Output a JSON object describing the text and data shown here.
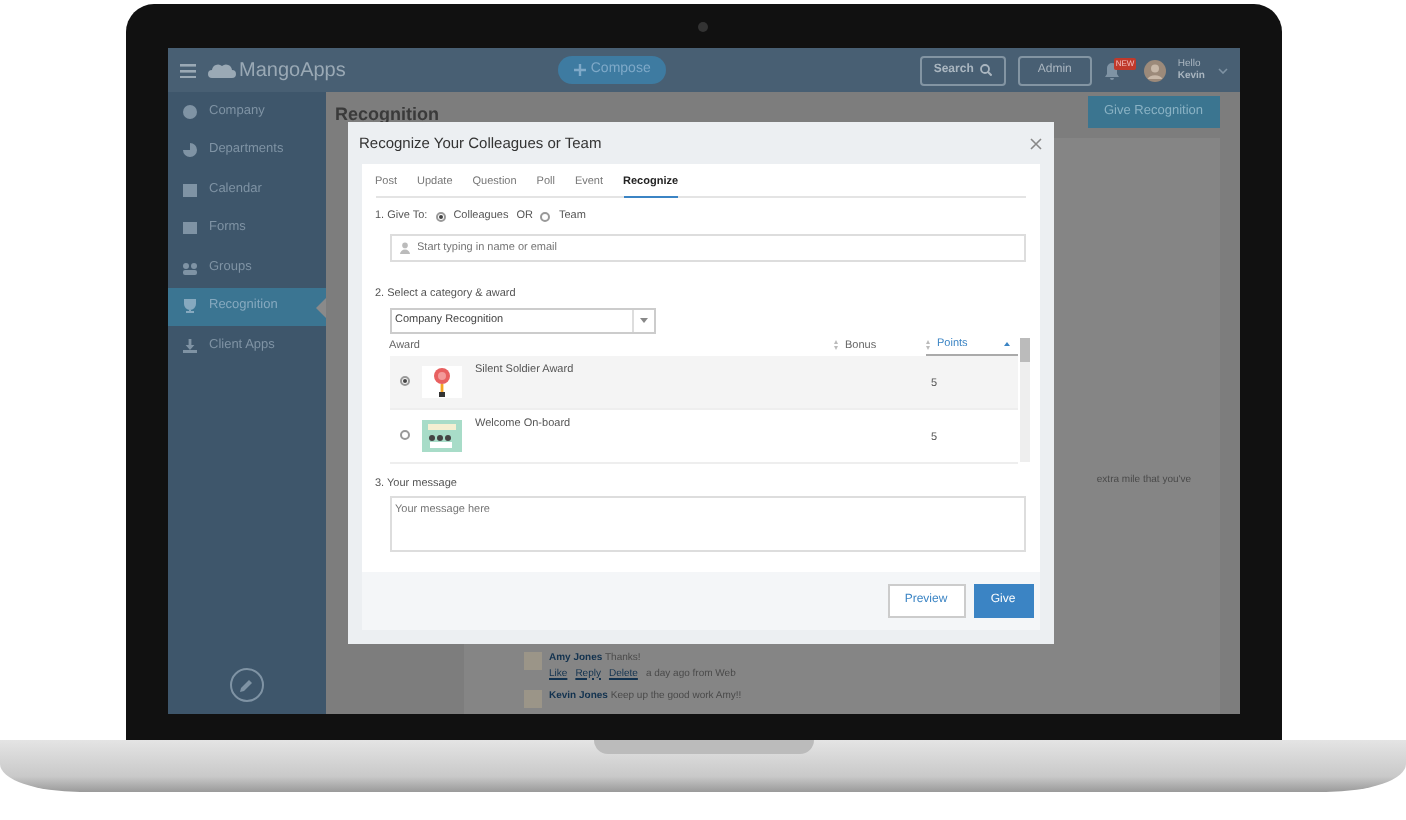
{
  "navbar": {
    "app_name": "MangoApps",
    "compose": "Compose",
    "search": "Search",
    "admin": "Admin",
    "notification_badge": "NEW",
    "greeting": "Hello",
    "user": "Kevin"
  },
  "sidebar": {
    "items": [
      {
        "label": "Company",
        "selected": false
      },
      {
        "label": "Departments",
        "selected": false
      },
      {
        "label": "Calendar",
        "selected": false
      },
      {
        "label": "Forms",
        "selected": false
      },
      {
        "label": "Groups",
        "selected": false
      },
      {
        "label": "Recognition",
        "selected": true
      },
      {
        "label": "Client Apps",
        "selected": false
      }
    ]
  },
  "page": {
    "title": "Recognition",
    "action": "Give Recognition",
    "feed_text": "extra mile that you've",
    "comments": [
      {
        "author": "Amy Jones",
        "text": "Thanks!",
        "actions": [
          "Like",
          "Reply",
          "Delete"
        ],
        "meta": "a day ago from Web"
      },
      {
        "author": "Kevin Jones",
        "text": "Keep up the good work Amy!!"
      }
    ]
  },
  "dialog": {
    "title": "Recognize Your Colleagues or Team",
    "tabs": [
      {
        "label": "Post",
        "selected": false
      },
      {
        "label": "Update",
        "selected": false
      },
      {
        "label": "Question",
        "selected": false
      },
      {
        "label": "Poll",
        "selected": false
      },
      {
        "label": "Event",
        "selected": false
      },
      {
        "label": "Recognize",
        "selected": true
      }
    ],
    "give_to": {
      "label": "1. Give To:",
      "separator": "OR",
      "options": [
        {
          "label": "Colleagues",
          "selected": true
        },
        {
          "label": "Team",
          "selected": false
        }
      ]
    },
    "recipient": {
      "placeholder": "Start typing in name or email"
    },
    "category": {
      "label": "2. Select a category & award",
      "value": "Company Recognition"
    },
    "awards": {
      "columns": [
        {
          "label": "Award",
          "sortable": false,
          "sorted": false
        },
        {
          "label": "Bonus",
          "sortable": true,
          "sorted": false
        },
        {
          "label": "Points",
          "sortable": true,
          "sorted": true
        }
      ],
      "rows": [
        {
          "name": "Silent Soldier Award",
          "points": "5",
          "kind": "medal",
          "selected": true
        },
        {
          "name": "Welcome On-board",
          "points": "5",
          "kind": "banner",
          "selected": false
        }
      ]
    },
    "message": {
      "label": "3. Your message",
      "placeholder": "Your message here"
    },
    "buttons": [
      {
        "label": "Preview",
        "kind": "secondary"
      },
      {
        "label": "Give",
        "kind": "primary"
      }
    ]
  }
}
